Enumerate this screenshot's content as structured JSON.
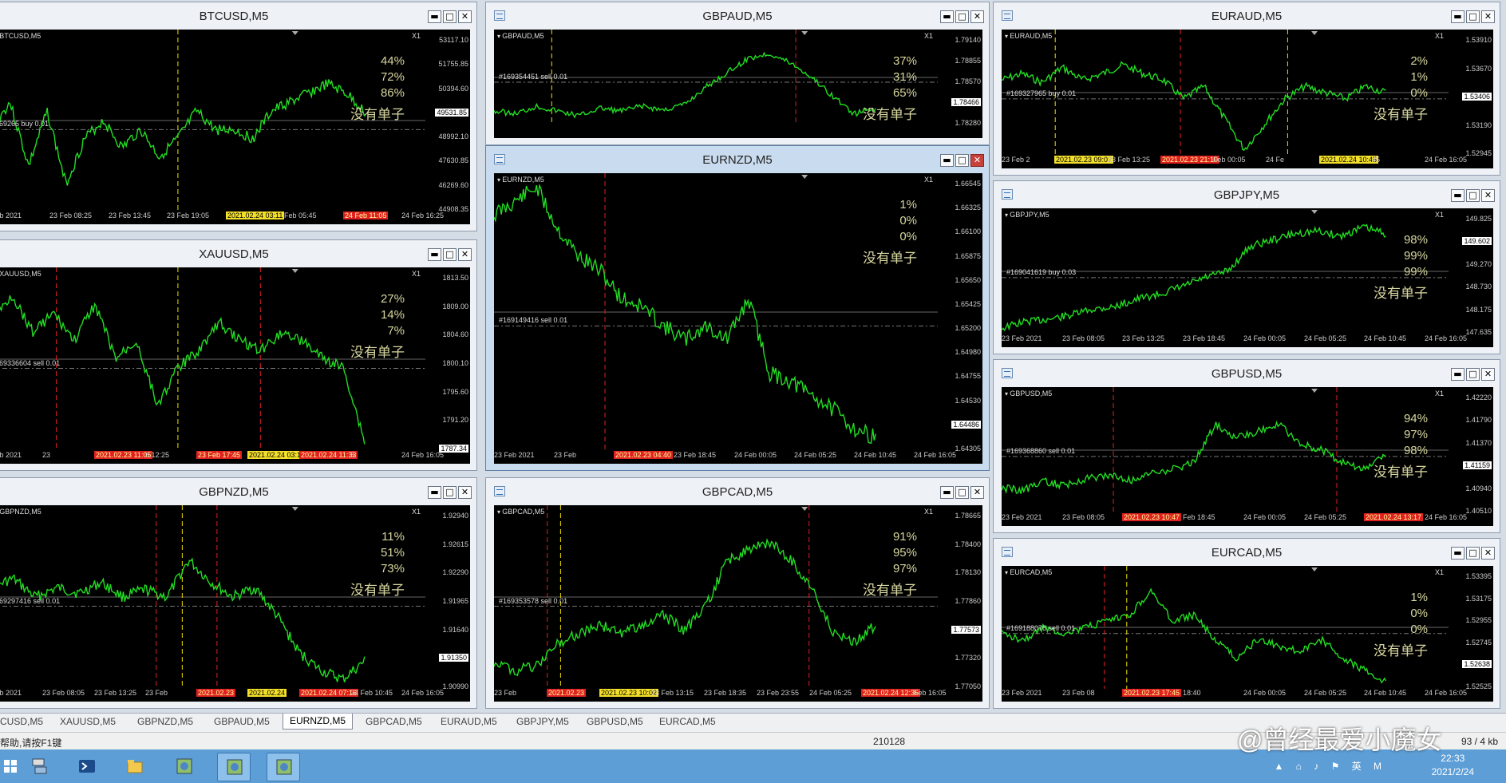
{
  "colors": {
    "bg": "#000000",
    "price": "#22dd22",
    "grid": "#888888",
    "red_line": "#e02020",
    "yellow_line": "#f0e000"
  },
  "windows": [
    {
      "id": "btcusd",
      "title": "BTCUSD,M5",
      "sym": "BTCUSD,M5",
      "zoom": "X1",
      "pcts": [
        "44%",
        "72%",
        "86%"
      ],
      "note": "没有单子",
      "order": "#169265 buy 0.01",
      "prices": [
        "53117.10",
        "51755.85",
        "50394.60",
        "49531.85",
        "48992.10",
        "47630.85",
        "46269.60",
        "44908.35"
      ],
      "current": "49531.85",
      "times": [
        "Feb 2021",
        "23 Feb 08:25",
        "23 Feb 13:45",
        "23 Feb 19:05",
        "2021.02.24 03:11",
        "Feb 05:45",
        "24 Feb 11:05",
        "24 Feb 16:25"
      ]
    },
    {
      "id": "gbpaud",
      "title": "GBPAUD,M5",
      "sym": "GBPAUD,M5",
      "zoom": "X1",
      "pcts": [
        "37%",
        "31%",
        "65%"
      ],
      "note": "没有单子",
      "order": "#169354451 sell 0.01",
      "prices": [
        "1.79140",
        "1.78855",
        "1.78570",
        "1.78466",
        "1.78280"
      ],
      "current": "1.78466",
      "times": []
    },
    {
      "id": "euraud",
      "title": "EURAUD,M5",
      "sym": "EURAUD,M5",
      "zoom": "X1",
      "pcts": [
        "2%",
        "1%",
        "0%"
      ],
      "note": "没有单子",
      "order": "#169327965 buy 0.01",
      "prices": [
        "1.53910",
        "1.53670",
        "1.53406",
        "1.53190",
        "1.52945"
      ],
      "current": "1.53406",
      "times": [
        "23 Feb 2",
        "2021.02.23 09:02",
        "23 Feb 13:25",
        "2021.02.23 21:10",
        "Feb 00:05",
        "24 Fe",
        "2021.02.24 10:45",
        "45",
        "24 Feb 16:05"
      ]
    },
    {
      "id": "xauusd",
      "title": "XAUUSD,M5",
      "sym": "XAUUSD,M5",
      "zoom": "X1",
      "pcts": [
        "27%",
        "14%",
        "7%"
      ],
      "note": "没有单子",
      "order": "#169336604 sell 0.01",
      "prices": [
        "1813.50",
        "1809.00",
        "1804.60",
        "1800.10",
        "1795.60",
        "1791.20",
        "1787.34"
      ],
      "current": "1787.34",
      "times": [
        "Feb 2021",
        "23",
        "2021.02.23 11:05",
        "b 12:25",
        "23 Feb 17:45",
        "2021.02.24 03:17",
        "2021.02.24 11:33",
        "5",
        "24 Feb 16:05"
      ]
    },
    {
      "id": "eurnzd",
      "title": "EURNZD,M5",
      "sym": "EURNZD,M5",
      "zoom": "X1",
      "pcts": [
        "1%",
        "0%",
        "0%"
      ],
      "note": "没有单子",
      "order": "#169149416 sell 0.01",
      "prices": [
        "1.66545",
        "1.66325",
        "1.66100",
        "1.65875",
        "1.65650",
        "1.65425",
        "1.65200",
        "1.64980",
        "1.64755",
        "1.64530",
        "1.64486",
        "1.64305"
      ],
      "current": "1.64486",
      "times": [
        "23 Feb 2021",
        "23 Feb",
        "2021.02.23 04:40",
        "23 Feb 18:45",
        "24 Feb 00:05",
        "24 Feb 05:25",
        "24 Feb 10:45",
        "24 Feb 16:05"
      ]
    },
    {
      "id": "gbpjpy",
      "title": "GBPJPY,M5",
      "sym": "GBPJPY,M5",
      "zoom": "X1",
      "pcts": [
        "98%",
        "99%",
        "99%"
      ],
      "note": "没有单子",
      "order": "#169041619 buy 0.03",
      "prices": [
        "149.825",
        "149.602",
        "149.270",
        "148.730",
        "148.175",
        "147.635"
      ],
      "current": "149.602",
      "times": [
        "23 Feb 2021",
        "23 Feb 08:05",
        "23 Feb 13:25",
        "23 Feb 18:45",
        "24 Feb 00:05",
        "24 Feb 05:25",
        "24 Feb 10:45",
        "24 Feb 16:05"
      ]
    },
    {
      "id": "gbpusd",
      "title": "GBPUSD,M5",
      "sym": "GBPUSD,M5",
      "zoom": "X1",
      "pcts": [
        "94%",
        "97%",
        "98%"
      ],
      "note": "没有单子",
      "order": "#169368860 sell 0.01",
      "prices": [
        "1.42220",
        "1.41790",
        "1.41370",
        "1.41159",
        "1.40940",
        "1.40510"
      ],
      "current": "1.41159",
      "times": [
        "23 Feb 2021",
        "23 Feb 08:05",
        "2021.02.23 10:47",
        "Feb 18:45",
        "24 Feb 00:05",
        "24 Feb 05:25",
        "2021.02.24 13:17",
        "24 Feb 16:05"
      ]
    },
    {
      "id": "gbpnzd",
      "title": "GBPNZD,M5",
      "sym": "GBPNZD,M5",
      "zoom": "X1",
      "pcts": [
        "11%",
        "51%",
        "73%"
      ],
      "note": "没有单子",
      "order": "#169297416 sell 0.01",
      "prices": [
        "1.92940",
        "1.92615",
        "1.92290",
        "1.91965",
        "1.91640",
        "1.91350",
        "1.90990"
      ],
      "current": "1.91350",
      "times": [
        "Feb 2021",
        "23 Feb 08:05",
        "23 Feb 13:25",
        "23 Feb",
        "2021.02.23",
        "2021.02.24",
        "2021.02.24 07:16",
        "24 Feb 10:45",
        "24 Feb 16:05"
      ]
    },
    {
      "id": "gbpcad",
      "title": "GBPCAD,M5",
      "sym": "GBPCAD,M5",
      "zoom": "X1",
      "pcts": [
        "91%",
        "95%",
        "97%"
      ],
      "note": "没有单子",
      "order": "#169353578 sell 0.01",
      "prices": [
        "1.78665",
        "1.78400",
        "1.78130",
        "1.77860",
        "1.77573",
        "1.77320",
        "1.77050"
      ],
      "current": "1.77573",
      "times": [
        "23 Feb",
        "2021.02.23",
        "2021.02.23 10:02",
        "23 Feb 13:15",
        "23 Feb 18:35",
        "23 Feb 23:55",
        "24 Feb 05:25",
        "2021.02.24 12:35",
        "Feb 16:05"
      ]
    },
    {
      "id": "eurcad",
      "title": "EURCAD,M5",
      "sym": "EURCAD,M5",
      "zoom": "X1",
      "pcts": [
        "1%",
        "0%",
        "0%"
      ],
      "note": "没有单子",
      "order": "#169188076 sell 0.01",
      "prices": [
        "1.53395",
        "1.53175",
        "1.52955",
        "1.52745",
        "1.52638",
        "1.52525"
      ],
      "current": "1.52638",
      "times": [
        "23 Feb 2021",
        "23 Feb 08",
        "2021.02.23 17:45",
        "18:40",
        "24 Feb 00:05",
        "24 Feb 05:25",
        "24 Feb 10:45",
        "24 Feb 16:05"
      ]
    }
  ],
  "tabs": [
    "CUSD,M5",
    "XAUUSD,M5",
    "GBPNZD,M5",
    "GBPAUD,M5",
    "EURNZD,M5",
    "GBPCAD,M5",
    "EURAUD,M5",
    "GBPJPY,M5",
    "GBPUSD,M5",
    "EURCAD,M5"
  ],
  "active_tab": "EURNZD,M5",
  "status": {
    "help": "帮助,请按F1键",
    "code": "210128",
    "right": "93 / 4 kb"
  },
  "taskbar": {
    "time": "22:33",
    "date": "2021/2/24",
    "icons": [
      "start-icon",
      "server-manager-icon",
      "powershell-icon",
      "explorer-icon",
      "mt4-icon",
      "mt4-icon",
      "mt4-icon"
    ]
  },
  "watermark": "@曾经最爱小魔女"
}
